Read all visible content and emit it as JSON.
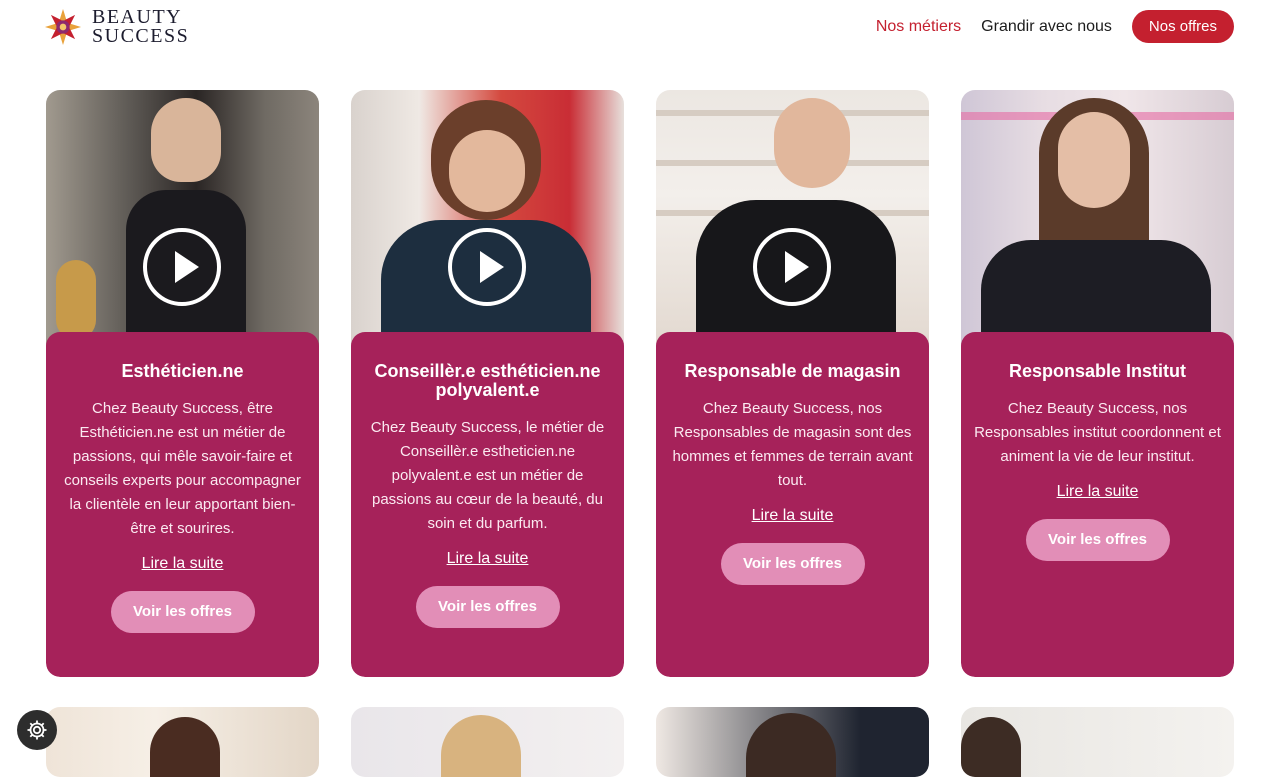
{
  "brand": {
    "line1": "BEAUTY",
    "line2": "SUCCESS"
  },
  "nav": {
    "metiers": "Nos métiers",
    "grandir": "Grandir avec nous",
    "offres": "Nos offres"
  },
  "cards": [
    {
      "title": "Esthéticien.ne",
      "text": "Chez Beauty Success, être Esthéticien.ne est un métier de passions, qui mêle savoir-faire et conseils experts pour accompagner la clientèle en leur apportant bien-être et sourires.",
      "link": "Lire la suite",
      "button": "Voir les offres"
    },
    {
      "title": "Conseillèr.e esthéticien.ne polyvalent.e",
      "text": "Chez Beauty Success, le métier de Conseillèr.e estheticien.ne polyvalent.e est un métier de passions au cœur de la beauté, du soin et du parfum.",
      "link": "Lire la suite",
      "button": "Voir les offres"
    },
    {
      "title": "Responsable de magasin",
      "text": "Chez Beauty Success, nos Responsables de magasin sont des hommes et femmes de terrain avant tout.",
      "link": "Lire la suite",
      "button": "Voir les offres"
    },
    {
      "title": "Responsable Institut",
      "text": "Chez Beauty Success, nos Responsables institut coordonnent et animent la vie de leur institut.",
      "link": "Lire la suite",
      "button": "Voir les offres"
    }
  ],
  "colors": {
    "accent": "#c4202f",
    "card": "#a6225a",
    "button": "#e28eb7"
  }
}
